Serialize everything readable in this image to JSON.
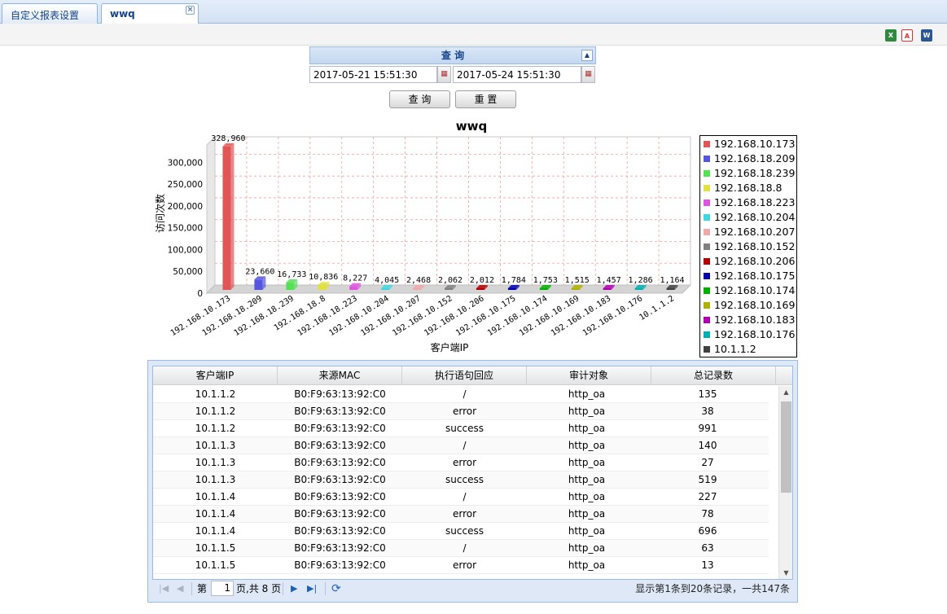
{
  "tabs": [
    {
      "label": "自定义报表设置",
      "active": false
    },
    {
      "label": "wwq",
      "active": true,
      "close": "×"
    }
  ],
  "toolbar": {
    "icons": [
      "excel-export-icon",
      "pdf-export-icon",
      "word-export-icon"
    ]
  },
  "query": {
    "title": "查 询",
    "start_date": "2017-05-21 15:51:30",
    "end_date": "2017-05-24 15:51:30",
    "query_button": "查 询",
    "reset_button": "重 置"
  },
  "chart_data": {
    "type": "bar",
    "title": "wwq",
    "xlabel": "客户端IP",
    "ylabel": "访问次数",
    "ylim": [
      0,
      340000
    ],
    "yticks": [
      "0",
      "50,000",
      "100,000",
      "150,000",
      "200,000",
      "250,000",
      "300,000"
    ],
    "grid": true,
    "legend_position": "right",
    "categories": [
      "192.168.10.173",
      "192.168.18.209",
      "192.168.18.239",
      "192.168.18.8",
      "192.168.18.223",
      "192.168.10.204",
      "192.168.10.207",
      "192.168.10.152",
      "192.168.10.206",
      "192.168.10.175",
      "192.168.10.174",
      "192.168.10.169",
      "192.168.10.183",
      "192.168.10.176",
      "10.1.1.2"
    ],
    "values": [
      328960,
      23660,
      16733,
      10836,
      8227,
      4045,
      2468,
      2062,
      2012,
      1784,
      1753,
      1515,
      1457,
      1286,
      1164
    ],
    "value_labels": [
      "328,960",
      "23,660",
      "16,733",
      "10,836",
      "8,227",
      "4,045",
      "2,468",
      "2,062",
      "2,012",
      "1,784",
      "1,753",
      "1,515",
      "1,457",
      "1,286",
      "1,164"
    ],
    "colors": [
      "#e05555",
      "#5555e0",
      "#55e055",
      "#e0e040",
      "#e055e0",
      "#40d8e0",
      "#f0a8a8",
      "#808080",
      "#b00000",
      "#0000b0",
      "#00b000",
      "#b0b000",
      "#b000b0",
      "#00b0b0",
      "#404040"
    ]
  },
  "grid": {
    "columns": [
      "客户端IP",
      "来源MAC",
      "执行语句回应",
      "审计对象",
      "总记录数"
    ],
    "rows": [
      [
        "10.1.1.2",
        "B0:F9:63:13:92:C0",
        "/",
        "http_oa",
        "135"
      ],
      [
        "10.1.1.2",
        "B0:F9:63:13:92:C0",
        "error",
        "http_oa",
        "38"
      ],
      [
        "10.1.1.2",
        "B0:F9:63:13:92:C0",
        "success",
        "http_oa",
        "991"
      ],
      [
        "10.1.1.3",
        "B0:F9:63:13:92:C0",
        "/",
        "http_oa",
        "140"
      ],
      [
        "10.1.1.3",
        "B0:F9:63:13:92:C0",
        "error",
        "http_oa",
        "27"
      ],
      [
        "10.1.1.3",
        "B0:F9:63:13:92:C0",
        "success",
        "http_oa",
        "519"
      ],
      [
        "10.1.1.4",
        "B0:F9:63:13:92:C0",
        "/",
        "http_oa",
        "227"
      ],
      [
        "10.1.1.4",
        "B0:F9:63:13:92:C0",
        "error",
        "http_oa",
        "78"
      ],
      [
        "10.1.1.4",
        "B0:F9:63:13:92:C0",
        "success",
        "http_oa",
        "696"
      ],
      [
        "10.1.1.5",
        "B0:F9:63:13:92:C0",
        "/",
        "http_oa",
        "63"
      ],
      [
        "10.1.1.5",
        "B0:F9:63:13:92:C0",
        "error",
        "http_oa",
        "13"
      ]
    ]
  },
  "pager": {
    "page_prefix": "第",
    "current_page": "1",
    "page_suffix": "页,共 8 页",
    "info": "显示第1条到20条记录，一共147条"
  }
}
